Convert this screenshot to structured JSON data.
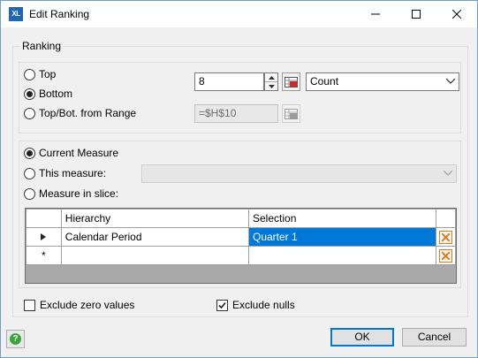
{
  "window": {
    "title": "Edit Ranking",
    "icon_text": "XL"
  },
  "ranking_group": {
    "label": "Ranking"
  },
  "rank_mode": {
    "options": [
      {
        "label": "Top",
        "checked": false
      },
      {
        "label": "Bottom",
        "checked": true
      },
      {
        "label": "Top/Bot. from Range",
        "checked": false
      }
    ],
    "count_value": "8",
    "aggregate_selected": "Count",
    "range_value": "=$H$10"
  },
  "measure_mode": {
    "options": [
      {
        "label": "Current Measure",
        "checked": true
      },
      {
        "label": "This measure:",
        "checked": false
      },
      {
        "label": "Measure in slice:",
        "checked": false
      }
    ],
    "this_measure_value": ""
  },
  "slice_grid": {
    "columns": [
      "Hierarchy",
      "Selection"
    ],
    "rows": [
      {
        "marker": "▶",
        "hierarchy": "Calendar Period",
        "selection": "Quarter 1"
      },
      {
        "marker": "*",
        "hierarchy": "",
        "selection": ""
      }
    ]
  },
  "options": {
    "exclude_zero": {
      "label": "Exclude zero values",
      "checked": false
    },
    "exclude_nulls": {
      "label": "Exclude nulls",
      "checked": true
    }
  },
  "buttons": {
    "ok": "OK",
    "cancel": "Cancel"
  },
  "colors": {
    "accent": "#0078d7",
    "delete": "#e07a1e",
    "help": "#3aa63a"
  }
}
